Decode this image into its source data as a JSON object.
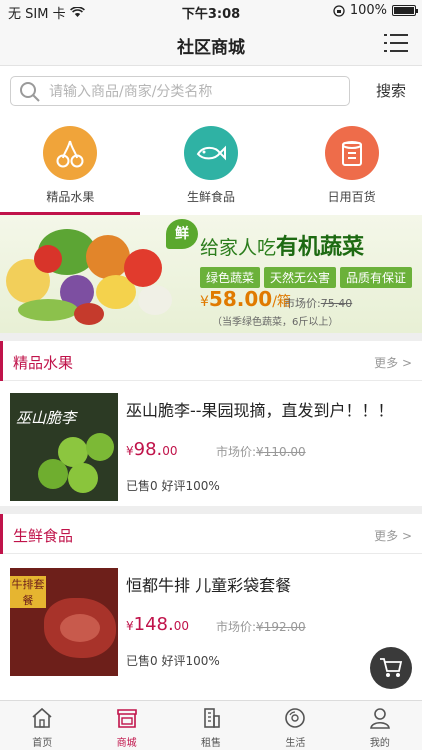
{
  "status_bar": {
    "carrier": "无 SIM 卡",
    "time": "下午3:08",
    "battery": "100%"
  },
  "nav": {
    "title": "社区商城",
    "menu_icon": "menu-icon"
  },
  "search": {
    "placeholder": "请输入商品/商家/分类名称",
    "value": "",
    "button": "搜索"
  },
  "categories": [
    {
      "label": "精品水果",
      "icon": "cherry-icon",
      "color": "#f0a43a"
    },
    {
      "label": "生鲜食品",
      "icon": "fish-icon",
      "color": "#2fb2a4"
    },
    {
      "label": "日用百货",
      "icon": "tissue-icon",
      "color": "#ee6c4a"
    }
  ],
  "banner": {
    "badge": "鲜",
    "headline_prefix": "给家人吃",
    "headline_main": "有机蔬菜",
    "tags": [
      "绿色蔬菜",
      "天然无公害",
      "品质有保证"
    ],
    "currency": "¥",
    "price": "58.00",
    "unit": "/箱",
    "market_label": "市场价:",
    "market_price": "75.40",
    "note": "（当季绿色蔬菜，6斤以上）"
  },
  "sections": [
    {
      "title": "精品水果",
      "more": "更多",
      "product": {
        "title": "巫山脆李--果园现摘，直发到户！！！",
        "currency": "¥",
        "price_int": "98.",
        "price_dec": "00",
        "market": "市场价:",
        "market_price": "¥110.00",
        "sold": "已售0",
        "rating": "好评100%",
        "img_text": "巫山脆李"
      }
    },
    {
      "title": "生鲜食品",
      "more": "更多",
      "product": {
        "title": "恒都牛排 儿童彩袋套餐",
        "currency": "¥",
        "price_int": "148.",
        "price_dec": "00",
        "market": "市场价:",
        "market_price": "¥192.00",
        "sold": "已售0",
        "rating": "好评100%",
        "img_text": "牛排套餐"
      }
    }
  ],
  "tabs": [
    {
      "label": "首页",
      "icon": "home-icon"
    },
    {
      "label": "商城",
      "icon": "shop-icon",
      "active": true
    },
    {
      "label": "租售",
      "icon": "building-icon"
    },
    {
      "label": "生活",
      "icon": "life-icon"
    },
    {
      "label": "我的",
      "icon": "user-icon"
    }
  ],
  "accent_color": "#c0134a"
}
